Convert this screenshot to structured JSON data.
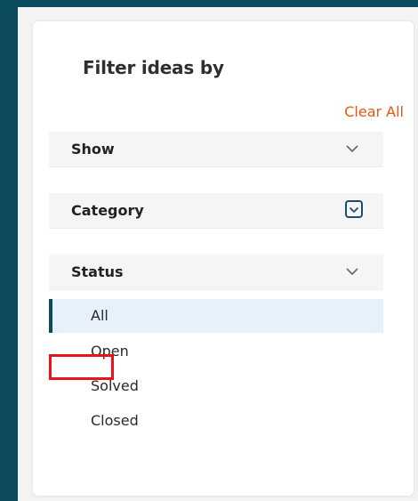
{
  "panel": {
    "title": "Filter ideas by",
    "clear_all": "Clear All"
  },
  "sections": [
    {
      "label": "Show",
      "chevron": "chevron-down-icon",
      "focused": false
    },
    {
      "label": "Category",
      "chevron": "chevron-down-icon",
      "focused": true
    },
    {
      "label": "Status",
      "chevron": "chevron-down-icon",
      "focused": false
    }
  ],
  "status_options": [
    {
      "label": "All",
      "selected": true
    },
    {
      "label": "Open",
      "selected": false
    },
    {
      "label": "Solved",
      "selected": false,
      "highlighted": true
    },
    {
      "label": "Closed",
      "selected": false
    }
  ],
  "colors": {
    "frame": "#0c4b5d",
    "accent_link": "#e15a12",
    "selected_bg": "#e6f1fb",
    "highlight_border": "#e8131b"
  }
}
